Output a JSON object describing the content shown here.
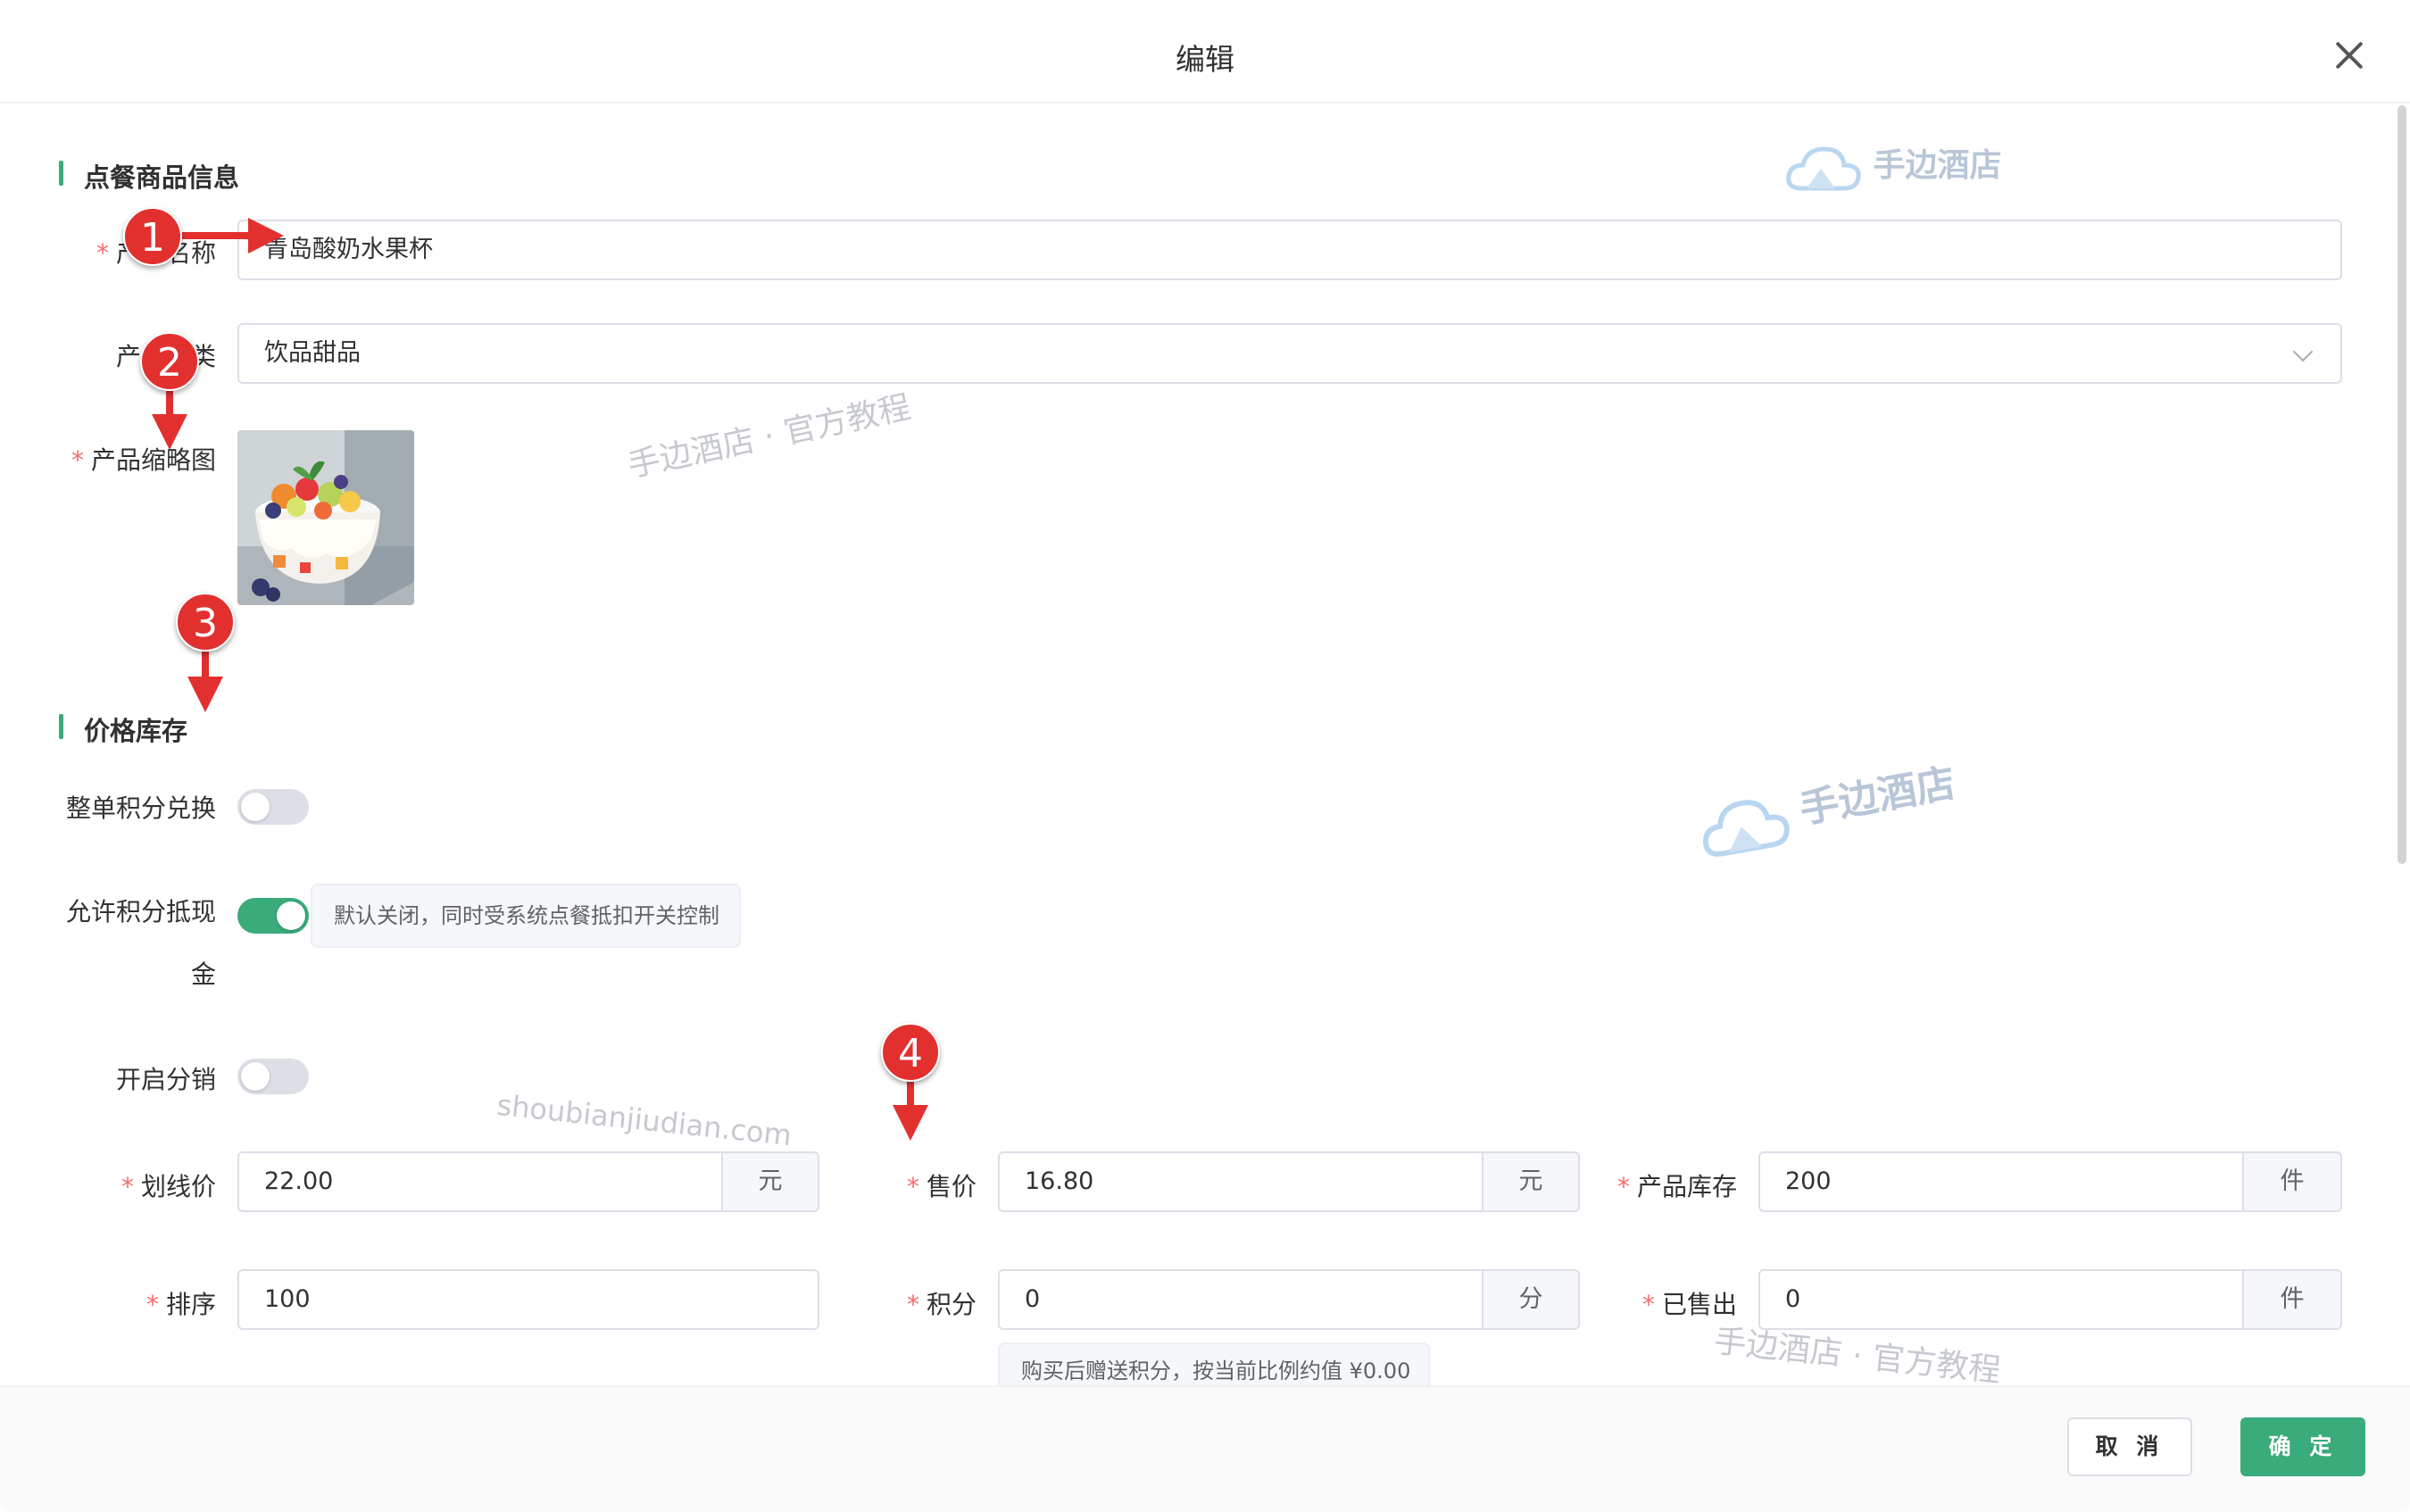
{
  "dialog": {
    "title": "编辑"
  },
  "section_product": {
    "title": "点餐商品信息"
  },
  "fields": {
    "product_name": {
      "label": "产品名称",
      "value": "青岛酸奶水果杯"
    },
    "category": {
      "label": "产品分类",
      "value": "饮品甜品"
    },
    "thumbnail": {
      "label": "产品缩略图"
    }
  },
  "section_price": {
    "title": "价格库存"
  },
  "toggles": {
    "whole_points": {
      "label": "整单积分兑换",
      "on": false
    },
    "allow_points_cash": {
      "label_line1": "允许积分抵现",
      "label_line2": "金",
      "on": true,
      "hint": "默认关闭，同时受系统点餐抵扣开关控制"
    },
    "distribution": {
      "label": "开启分销",
      "on": false
    }
  },
  "price": {
    "original": {
      "label": "划线价",
      "value": "22.00",
      "unit": "元"
    },
    "sale": {
      "label": "售价",
      "value": "16.80",
      "unit": "元"
    },
    "stock": {
      "label": "产品库存",
      "value": "200",
      "unit": "件"
    },
    "sort": {
      "label": "排序",
      "value": "100"
    },
    "points": {
      "label": "积分",
      "value": "0",
      "unit": "分",
      "hint": "购买后赠送积分，按当前比例约值 ¥0.00"
    },
    "sold": {
      "label": "已售出",
      "value": "0",
      "unit": "件"
    }
  },
  "buttons": {
    "cancel": "取 消",
    "confirm": "确 定"
  },
  "markers": [
    "1",
    "2",
    "3",
    "4"
  ],
  "watermarks": {
    "logo_text": "手边酒店",
    "tutorial": "手边酒店 · 官方教程",
    "domain": "shoubianjiudian.com"
  },
  "colors": {
    "accent": "#3aab7b",
    "required": "#f56c6c",
    "marker": "#e2302f"
  }
}
